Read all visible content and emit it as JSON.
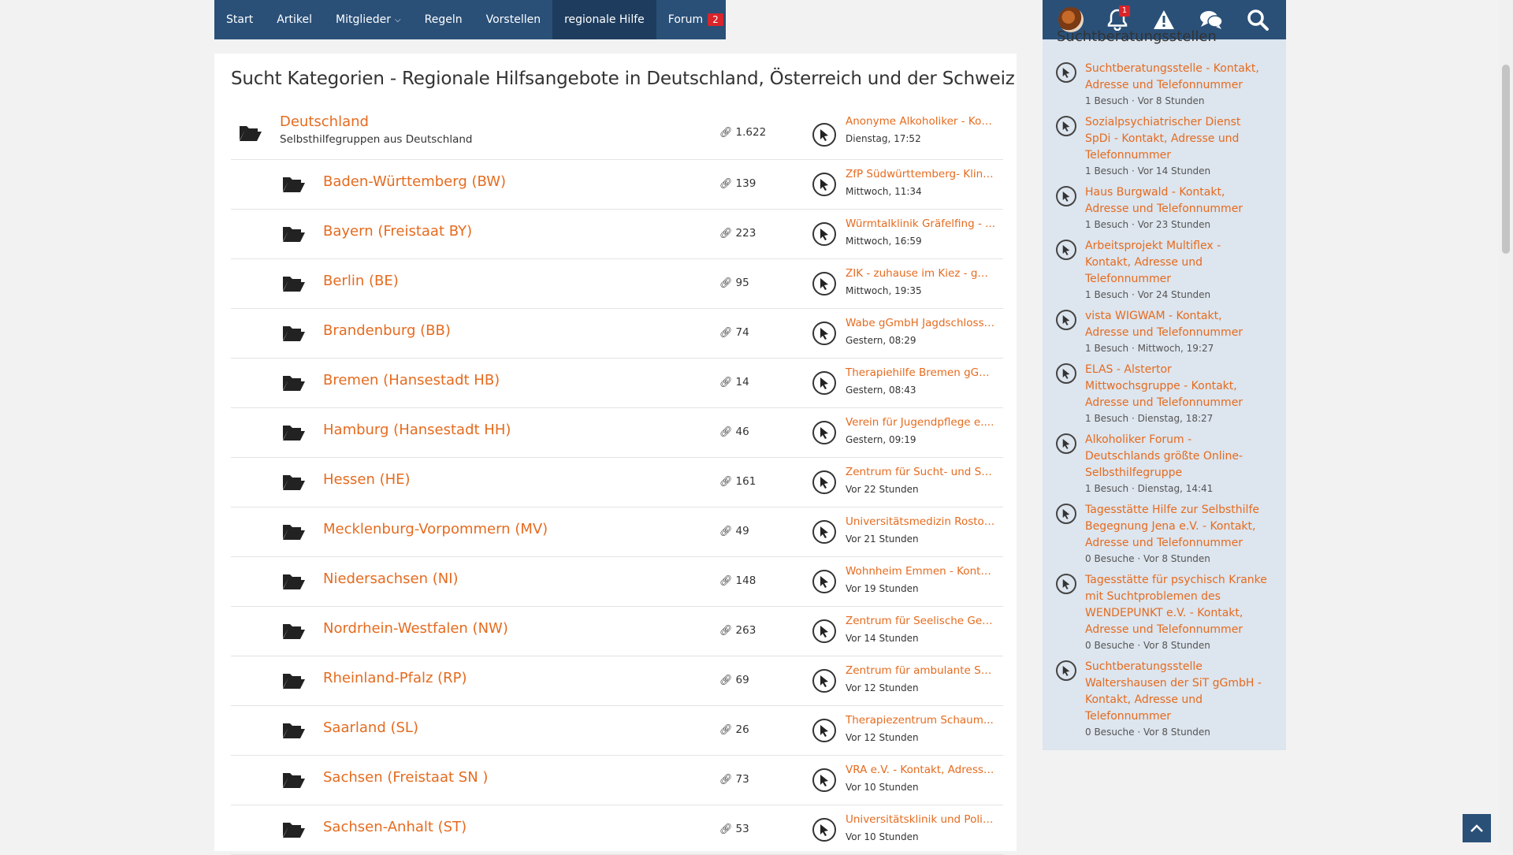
{
  "nav": {
    "items": [
      {
        "label": "Start"
      },
      {
        "label": "Artikel"
      },
      {
        "label": "Mitglieder"
      },
      {
        "label": "Regeln"
      },
      {
        "label": "Vorstellen"
      },
      {
        "label": "regionale Hilfe"
      },
      {
        "label": "Forum"
      }
    ],
    "forum_badge": "2",
    "notification_count": "1",
    "colors": {
      "bar": "#2a5078",
      "active": "#1e3d5e",
      "badge": "#d9242a"
    }
  },
  "page": {
    "title": "Sucht Kategorien - Regionale Hilfsangebote in Deutschland, Österreich und der Schweiz",
    "accent_color": "#e56b1f"
  },
  "top_category": {
    "title": "Deutschland",
    "subtitle": "Selbsthilfegruppen aus Deutschland",
    "count": "1.622",
    "last_title": "Anonyme Alkoholiker - Kon...",
    "last_time": "Dienstag, 17:52"
  },
  "categories": [
    {
      "title": "Baden-Württemberg (BW)",
      "count": "139",
      "last_title": "ZfP Südwürttemberg- Klini...",
      "last_time": "Mittwoch, 11:34"
    },
    {
      "title": "Bayern (Freistaat BY)",
      "count": "223",
      "last_title": "Würmtalklinik Gräfelfing - ...",
      "last_time": "Mittwoch, 16:59"
    },
    {
      "title": "Berlin (BE)",
      "count": "95",
      "last_title": "ZIK - zuhause im Kiez - gG...",
      "last_time": "Mittwoch, 19:35"
    },
    {
      "title": "Brandenburg (BB)",
      "count": "74",
      "last_title": "Wabe gGmbH Jagdschloss ...",
      "last_time": "Gestern, 08:29"
    },
    {
      "title": "Bremen (Hansestadt HB)",
      "count": "14",
      "last_title": "Therapiehilfe Bremen gGm...",
      "last_time": "Gestern, 08:43"
    },
    {
      "title": "Hamburg (Hansestadt HH)",
      "count": "46",
      "last_title": "Verein für Jugendpflege e....",
      "last_time": "Gestern, 09:19"
    },
    {
      "title": "Hessen (HE)",
      "count": "161",
      "last_title": "Zentrum für Sucht- und So...",
      "last_time": "Vor 22 Stunden"
    },
    {
      "title": "Mecklenburg-Vorpommern (MV)",
      "count": "49",
      "last_title": "Universitätsmedizin Rostoc...",
      "last_time": "Vor 21 Stunden"
    },
    {
      "title": "Niedersachsen (NI)",
      "count": "148",
      "last_title": "Wohnheim Emmen - Konta...",
      "last_time": "Vor 19 Stunden"
    },
    {
      "title": "Nordrhein-Westfalen (NW)",
      "count": "263",
      "last_title": "Zentrum für Seelische Ges...",
      "last_time": "Vor 14 Stunden"
    },
    {
      "title": "Rheinland-Pfalz (RP)",
      "count": "69",
      "last_title": "Zentrum für ambulante Su...",
      "last_time": "Vor 12 Stunden"
    },
    {
      "title": "Saarland (SL)",
      "count": "26",
      "last_title": "Therapiezentrum Schaum...",
      "last_time": "Vor 12 Stunden"
    },
    {
      "title": "Sachsen (Freistaat SN )",
      "count": "73",
      "last_title": "VRA e.V. - Kontakt, Adresse...",
      "last_time": "Vor 10 Stunden"
    },
    {
      "title": "Sachsen-Anhalt (ST)",
      "count": "53",
      "last_title": "Universitätsklinik und Polik...",
      "last_time": "Vor 10 Stunden"
    }
  ],
  "sidebar": {
    "heading": "Suchtberatungsstellen",
    "items": [
      {
        "title": "Suchtberatungsstelle - Kontakt, Adresse und Telefonnummer",
        "meta": "1 Besuch · Vor 8 Stunden"
      },
      {
        "title": "Sozialpsychiatrischer Dienst SpDi - Kontakt, Adresse und Telefonnummer",
        "meta": "1 Besuch · Vor 14 Stunden"
      },
      {
        "title": "Haus Burgwald - Kontakt, Adresse und Telefonnummer",
        "meta": "1 Besuch · Vor 23 Stunden"
      },
      {
        "title": "Arbeitsprojekt Multiflex - Kontakt, Adresse und Telefonnummer",
        "meta": "1 Besuch · Vor 24 Stunden"
      },
      {
        "title": "vista WIGWAM - Kontakt, Adresse und Telefonnummer",
        "meta": "1 Besuch · Mittwoch, 19:27"
      },
      {
        "title": "ELAS - Alstertor Mittwochsgruppe - Kontakt, Adresse und Telefonnummer",
        "meta": "1 Besuch · Dienstag, 18:27"
      },
      {
        "title": "Alkoholiker Forum - Deutschlands größte Online-Selbsthilfegruppe",
        "meta": "1 Besuch · Dienstag, 14:41"
      },
      {
        "title": "Tagesstätte Hilfe zur Selbsthilfe Begegnung Jena e.V. - Kontakt, Adresse und Telefonnummer",
        "meta": "0 Besuche · Vor 8 Stunden"
      },
      {
        "title": "Tagesstätte für psychisch Kranke mit Suchtproblemen des WENDEPUNKT e.V. - Kontakt, Adresse und Telefonnummer",
        "meta": "0 Besuche · Vor 8 Stunden"
      },
      {
        "title": "Suchtberatungsstelle Waltershausen der SiT gGmbH - Kontakt, Adresse und Telefonnummer",
        "meta": "0 Besuche · Vor 8 Stunden"
      }
    ]
  }
}
